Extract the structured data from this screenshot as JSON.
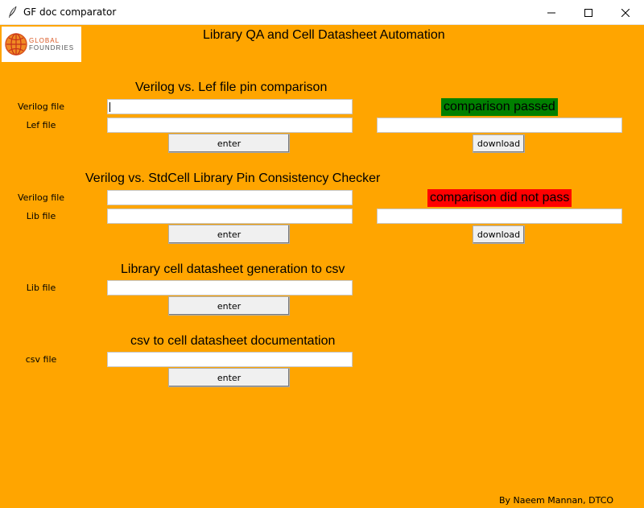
{
  "window": {
    "title": "GF doc comparator",
    "controls": {
      "minimize_icon": "minimize-icon",
      "maximize_icon": "maximize-icon",
      "close_icon": "close-icon"
    }
  },
  "app": {
    "title": "Library QA and Cell Datasheet Automation",
    "logo": {
      "line1": "GLOBAL",
      "line2": "FOUNDRIES"
    },
    "credit": "By Naeem Mannan, DTCO"
  },
  "sections": [
    {
      "heading": "Verilog vs. Lef file pin comparison",
      "fields": [
        {
          "label": "Verilog file",
          "value": ""
        },
        {
          "label": "Lef file",
          "value": ""
        }
      ],
      "button": "enter",
      "status": {
        "text": "comparison passed",
        "color": "#008000"
      },
      "result_value": "",
      "download": "download"
    },
    {
      "heading": "Verilog vs. StdCell Library Pin Consistency Checker",
      "fields": [
        {
          "label": "Verilog file",
          "value": ""
        },
        {
          "label": "Lib file",
          "value": ""
        }
      ],
      "button": "enter",
      "status": {
        "text": "comparison did not pass",
        "color": "#FF0000"
      },
      "result_value": "",
      "download": "download"
    },
    {
      "heading": "Library cell datasheet generation to csv",
      "fields": [
        {
          "label": "Lib file",
          "value": ""
        }
      ],
      "button": "enter"
    },
    {
      "heading": "csv to cell datasheet documentation",
      "fields": [
        {
          "label": "csv file",
          "value": ""
        }
      ],
      "button": "enter"
    }
  ],
  "colors": {
    "background": "#FFA500",
    "passed": "#008000",
    "failed": "#FF0000"
  }
}
